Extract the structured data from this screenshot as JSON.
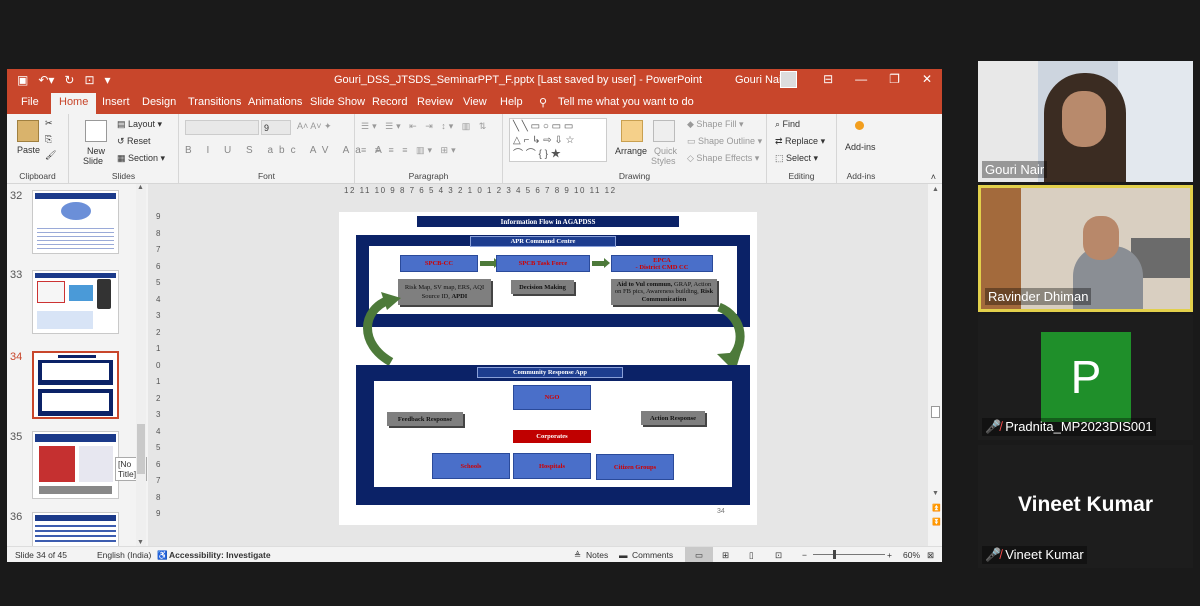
{
  "window": {
    "title": "Gouri_DSS_JTSDS_SeminarPPT_F.pptx [Last saved by user]  -  PowerPoint",
    "user": "Gouri Nair",
    "qat_icons": [
      "save-icon",
      "undo-icon",
      "redo-icon",
      "customize-icon"
    ]
  },
  "tabs": [
    "File",
    "Home",
    "Insert",
    "Design",
    "Transitions",
    "Animations",
    "Slide Show",
    "Record",
    "Review",
    "View",
    "Help"
  ],
  "tell_me": "Tell me what you want to do",
  "ribbon": {
    "clipboard": {
      "paste": "Paste",
      "label": "Clipboard"
    },
    "slides": {
      "new_slide_line1": "New",
      "new_slide_line2": "Slide",
      "layout": "Layout",
      "reset": "Reset",
      "section": "Section",
      "label": "Slides"
    },
    "font": {
      "size": "9",
      "label": "Font",
      "buttons": [
        "B",
        "I",
        "U",
        "S",
        "abc",
        "AV",
        "Aa",
        "A"
      ]
    },
    "paragraph": {
      "label": "Paragraph"
    },
    "drawing": {
      "arrange": "Arrange",
      "quick_line1": "Quick",
      "quick_line2": "Styles",
      "shape_fill": "Shape Fill",
      "shape_outline": "Shape Outline",
      "shape_effects": "Shape Effects",
      "label": "Drawing"
    },
    "editing": {
      "find": "Find",
      "replace": "Replace",
      "select": "Select",
      "label": "Editing"
    },
    "addins": {
      "addins": "Add-ins",
      "label": "Add-ins"
    }
  },
  "thumbnails": [
    {
      "num": "32"
    },
    {
      "num": "33"
    },
    {
      "num": "34"
    },
    {
      "num": "35"
    },
    {
      "num": "36"
    }
  ],
  "tooltip": "[No Title]",
  "ruler": {
    "horizontal": "12 11 10 9 8 7 6 5 4 3 2 1 0 1 2 3 4 5 6 7 8 9 10 11 12",
    "vertical": [
      "9",
      "8",
      "7",
      "6",
      "5",
      "4",
      "3",
      "2",
      "1",
      "0",
      "1",
      "2",
      "3",
      "4",
      "5",
      "6",
      "7",
      "8",
      "9"
    ]
  },
  "slide": {
    "title": "Information Flow in AGAPDSS",
    "top_header": "APR Command Centre",
    "spcb_cc": "SPCB-CC",
    "spcb_tf": "SPCB Task Force",
    "epca_line1": "EPCA",
    "epca_line2": "- District CMD CC",
    "risk_line1": "Risk Map, SV map, ERS, AQI",
    "risk_line2": "Source ID, ",
    "risk_bold": "APDI",
    "decision": "Decision Making",
    "aid_bold": "Aid to Vul commun,",
    "aid_rest": " GRAP, Action on FB pics, Awareness building, ",
    "aid_bold2": "Risk Communication",
    "bottom_header": "Community Response App",
    "ngo": "NGO",
    "corporates": "Corporates",
    "feedback": "Feedback Response",
    "action": "Action Response",
    "schools": "Schools",
    "hospitals": "Hospitals",
    "citizen": "Citizen Groups",
    "page_num": "34"
  },
  "status": {
    "slide_info": "Slide 34 of 45",
    "language": "English (India)",
    "accessibility": "Accessibility: Investigate",
    "notes": "Notes",
    "comments": "Comments",
    "zoom": "60%"
  },
  "participants": [
    {
      "name": "Gouri Nair",
      "muted": false
    },
    {
      "name": "Ravinder Dhiman",
      "muted": false
    },
    {
      "name": "Pradnita_MP2023DIS001",
      "muted": true,
      "initial": "P"
    },
    {
      "name": "Vineet Kumar",
      "muted": true,
      "display": "Vineet Kumar"
    }
  ],
  "colors": {
    "ppt_accent": "#c8462b",
    "slide_navy": "#0b2267",
    "box_blue": "#4a6fc9",
    "box_gray": "#7f7f7f",
    "arrow_green": "#4d7a3a",
    "red": "#d00000",
    "pradnita_tile": "#1f8f2a",
    "speaker_border": "#e2d04b"
  }
}
